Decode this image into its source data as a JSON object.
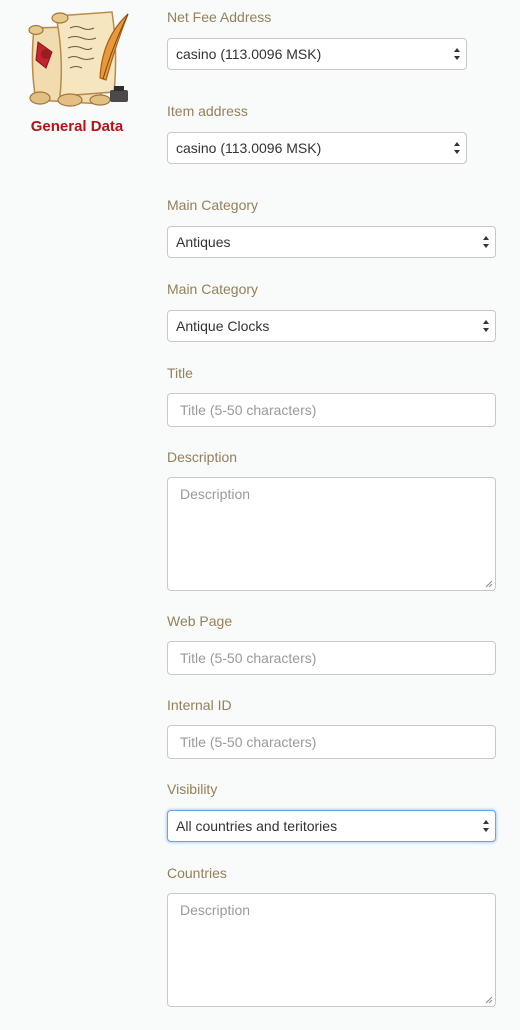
{
  "sidebar": {
    "section_title": "General Data",
    "logo_icon": "scroll-quill-icon"
  },
  "form": {
    "net_fee_address": {
      "label": "Net Fee Address",
      "value": "casino (113.0096 MSK)"
    },
    "item_address": {
      "label": "Item address",
      "value": "casino (113.0096 MSK)"
    },
    "main_category": {
      "label": "Main Category",
      "value": "Antiques"
    },
    "sub_category": {
      "label": "Main Category",
      "value": "Antique Clocks"
    },
    "title": {
      "label": "Title",
      "placeholder": "Title (5-50 characters)"
    },
    "description": {
      "label": "Description",
      "placeholder": "Description"
    },
    "web_page": {
      "label": "Web Page",
      "placeholder": "Title (5-50 characters)"
    },
    "internal_id": {
      "label": "Internal ID",
      "placeholder": "Title (5-50 characters)"
    },
    "visibility": {
      "label": "Visibility",
      "value": "All countries and teritories"
    },
    "countries": {
      "label": "Countries",
      "placeholder": "Description"
    }
  },
  "colors": {
    "label": "#94805a",
    "section_title": "#b3141a",
    "focus_border": "#6aa6dd"
  }
}
